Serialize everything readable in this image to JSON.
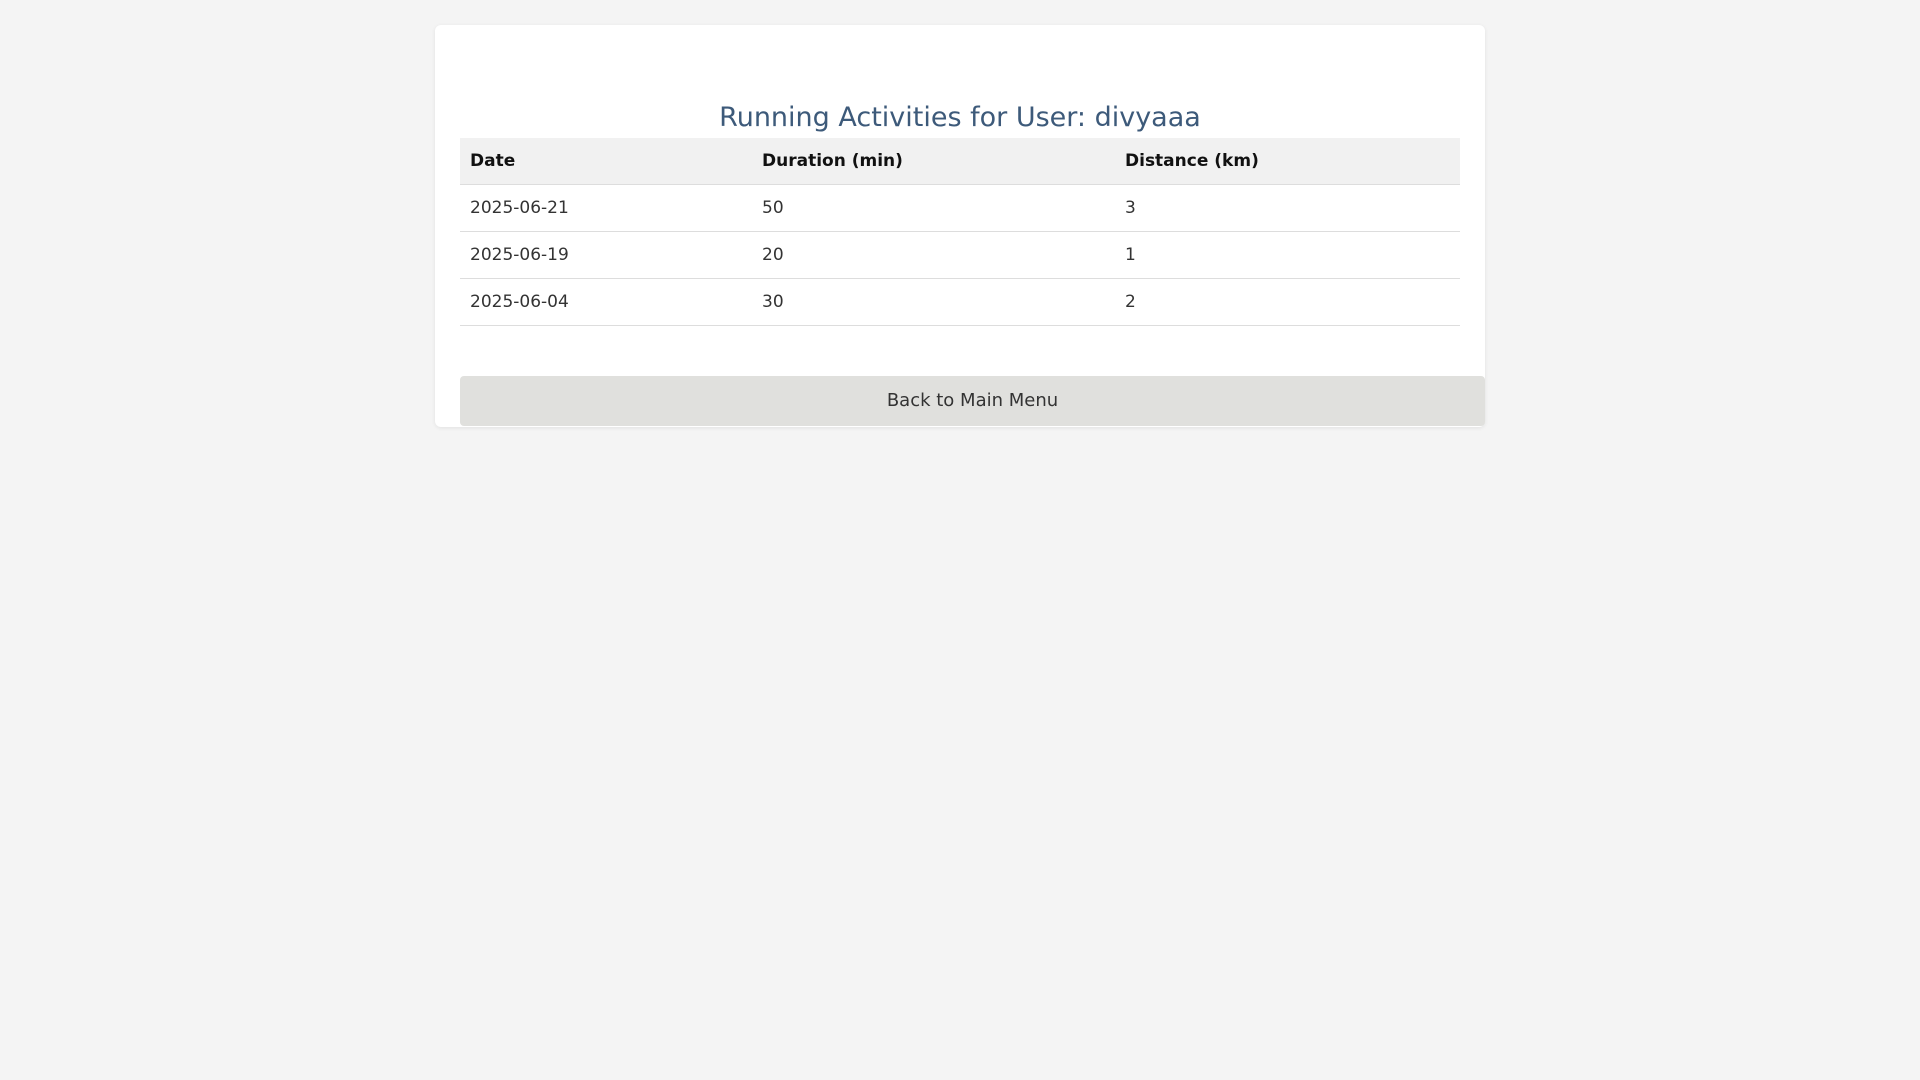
{
  "page": {
    "title": "Running Activities for User: divyaaa"
  },
  "table": {
    "headers": [
      "Date",
      "Duration (min)",
      "Distance (km)"
    ],
    "rows": [
      [
        "2025-06-21",
        "50",
        "3"
      ],
      [
        "2025-06-19",
        "20",
        "1"
      ],
      [
        "2025-06-04",
        "30",
        "2"
      ]
    ]
  },
  "actions": {
    "back_label": "Back to Main Menu"
  },
  "colors": {
    "title": "#3d5a7a",
    "page_background": "#f4f4f4",
    "card_background": "#ffffff",
    "header_background": "#f1f1f1",
    "button_background": "#e0e0dd"
  }
}
